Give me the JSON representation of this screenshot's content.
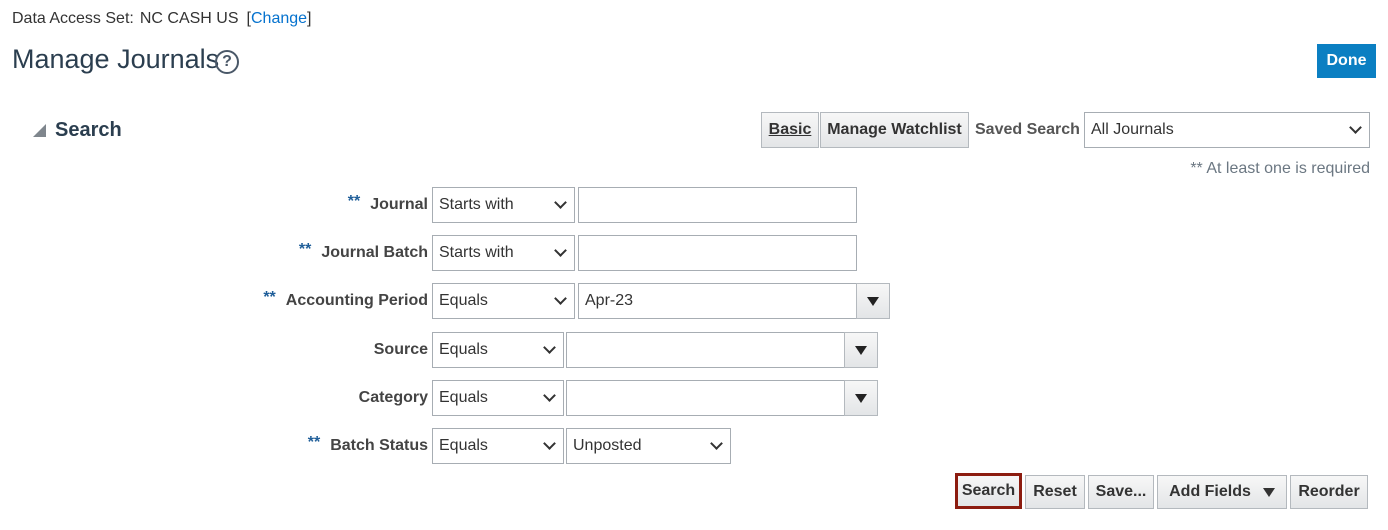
{
  "header": {
    "data_access_label": "Data Access Set:",
    "data_access_value": "NC CASH US",
    "bracket_open": "[",
    "change_link": "Change",
    "bracket_close": "]",
    "page_title": "Manage Journals",
    "help_glyph": "?",
    "done_label": "Done"
  },
  "search": {
    "section_title": "Search",
    "basic_label": "Basic",
    "manage_watchlist_label": "Manage Watchlist",
    "saved_search_label": "Saved Search",
    "saved_search_value": "All Journals",
    "required_note": "** At least one is required",
    "required_marker": "**",
    "fields": {
      "journal": {
        "label": "Journal",
        "operator": "Starts with",
        "value": ""
      },
      "journal_batch": {
        "label": "Journal Batch",
        "operator": "Starts with",
        "value": ""
      },
      "accounting_period": {
        "label": "Accounting Period",
        "operator": "Equals",
        "value": "Apr-23"
      },
      "source": {
        "label": "Source",
        "operator": "Equals",
        "value": ""
      },
      "category": {
        "label": "Category",
        "operator": "Equals",
        "value": ""
      },
      "batch_status": {
        "label": "Batch Status",
        "operator": "Equals",
        "value": "Unposted"
      }
    },
    "buttons": {
      "search": "Search",
      "reset": "Reset",
      "save": "Save...",
      "add_fields": "Add Fields",
      "reorder": "Reorder"
    }
  },
  "colors": {
    "accent_blue": "#0b7fc2",
    "link_blue": "#0572ce",
    "required_blue": "#1f5e99",
    "search_highlight": "#8c1c10"
  },
  "icons": {
    "help": "question-circle-icon",
    "disclosure": "triangle-expanded-icon",
    "dropdown": "chevron-down-icon",
    "lov": "triangle-down-icon"
  }
}
